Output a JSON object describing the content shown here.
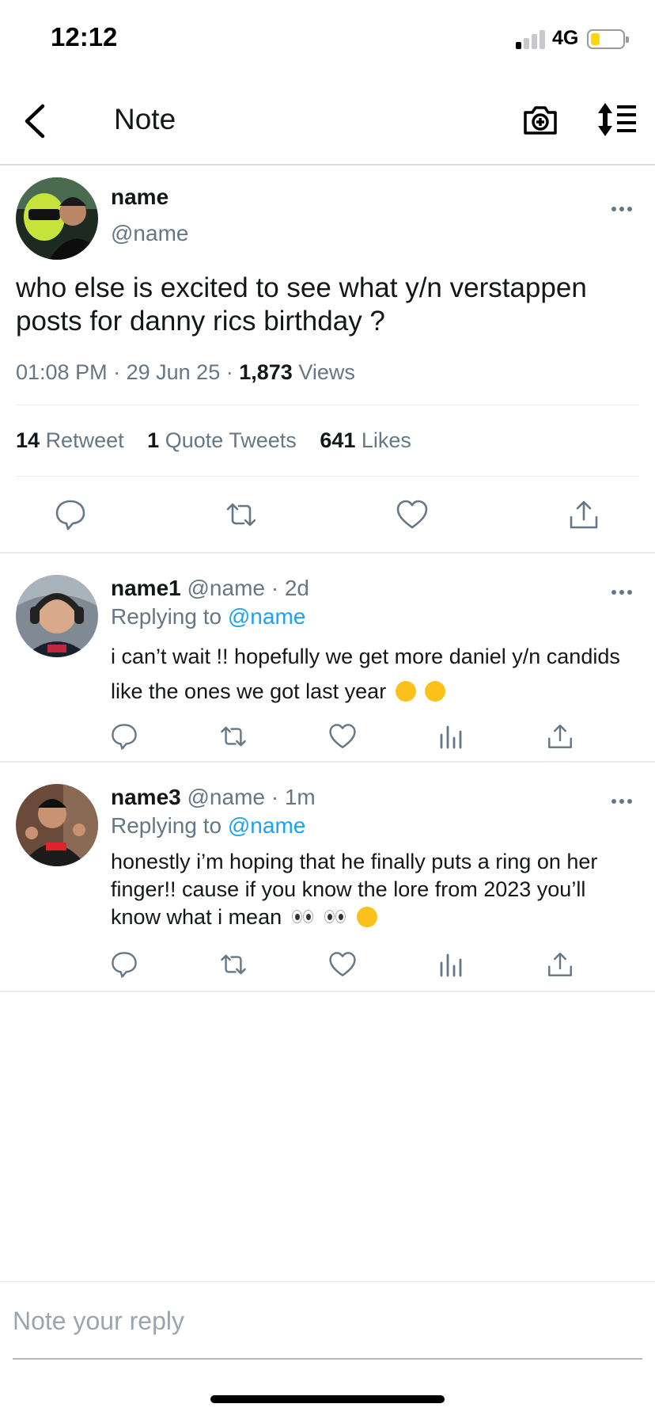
{
  "status_bar": {
    "time": "12:12",
    "network": "4G",
    "signal_bars_active": 1,
    "signal_bars_total": 4,
    "battery_level": 0.2,
    "battery_color": "#ffd60a"
  },
  "nav": {
    "title": "Note",
    "back_icon": "chevron-left-icon",
    "camera_icon": "camera-plus-icon",
    "sort_icon": "sort-list-icon"
  },
  "main_tweet": {
    "name": "name",
    "handle": "@name",
    "text": "who else is excited to see what y/n verstappen posts for danny rics birthday ?",
    "time": "01:08 PM",
    "date": "29 Jun 25",
    "views_count": "1,873",
    "views_label": "Views",
    "separator": "·",
    "retweets_count": "14",
    "retweets_label": "Retweet",
    "quotes_count": "1",
    "quotes_label": "Quote Tweets",
    "likes_count": "641",
    "likes_label": "Likes"
  },
  "replies": [
    {
      "name": "name1",
      "handle": "@name",
      "age": "2d",
      "replying_label": "Replying to",
      "replying_to": "@name",
      "text": "i can’t wait !! hopefully we get more daniel y/n candids like the ones we got last year",
      "emojis": [
        "thinking-face",
        "face-with-hand-over-mouth"
      ]
    },
    {
      "name": "name3",
      "handle": "@name",
      "age": "1m",
      "replying_label": "Replying to",
      "replying_to": "@name",
      "text": "honestly i’m hoping that he finally puts a ring on her finger!! cause if you know the lore from 2023 you’ll know what i mean",
      "emojis": [
        "eyes",
        "eyes",
        "winking-face"
      ]
    }
  ],
  "reply_box": {
    "placeholder": "Note your reply"
  },
  "colors": {
    "link": "#1da1f2",
    "secondary_text": "#657786",
    "primary_text": "#14171a",
    "divider": "#e6ecf0"
  }
}
